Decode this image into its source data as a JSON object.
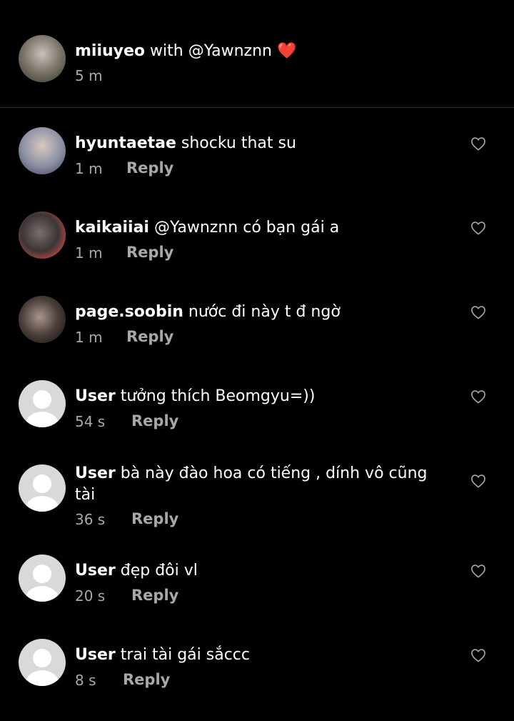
{
  "post": {
    "username": "miiuyeo",
    "with_text": "with @Yawnznn",
    "heart_emoji": "❤️",
    "time": "5 m"
  },
  "comments": [
    {
      "username": "hyuntaetae",
      "text": "shocku that su",
      "time": "1 m",
      "reply": "Reply"
    },
    {
      "username": "kaikaiiai",
      "text": "@Yawnznn có bạn gái a",
      "time": "1 m",
      "reply": "Reply"
    },
    {
      "username": "page.soobin",
      "text": "nước đi này t đ ngờ",
      "time": "1 m",
      "reply": "Reply"
    },
    {
      "username": "User",
      "text": "tưởng thích Beomgyu=))",
      "time": "54 s",
      "reply": "Reply"
    },
    {
      "username": "User",
      "text": "bà này đào hoa có tiếng , dính vô cũng tài",
      "time": "36 s",
      "reply": "Reply"
    },
    {
      "username": "User",
      "text": "đẹp đôi vl",
      "time": "20 s",
      "reply": "Reply"
    },
    {
      "username": "User",
      "text": "trai tài gái sắccc",
      "time": "8 s",
      "reply": "Reply"
    }
  ],
  "icons": {
    "like": "heart-outline-icon",
    "avatar_default": "default-user-icon"
  },
  "colors": {
    "background": "#000000",
    "text": "#ffffff",
    "meta": "#a8a8a8",
    "heart": "#ff3040"
  }
}
